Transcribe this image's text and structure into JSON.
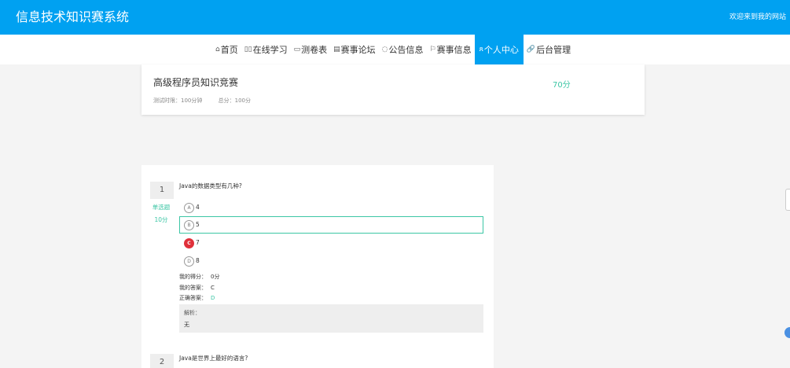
{
  "header": {
    "site_title": "信息技术知识赛系统",
    "welcome": "欢迎来到我的网站"
  },
  "nav": {
    "items": [
      {
        "label": "首页",
        "icon": "home-icon",
        "glyph": "⌂"
      },
      {
        "label": "在线学习",
        "icon": "book-icon",
        "glyph": "▯▯"
      },
      {
        "label": "测卷表",
        "icon": "paper-icon",
        "glyph": "▭"
      },
      {
        "label": "赛事论坛",
        "icon": "forum-icon",
        "glyph": "▤"
      },
      {
        "label": "公告信息",
        "icon": "notice-icon",
        "glyph": "◌"
      },
      {
        "label": "赛事信息",
        "icon": "flag-icon",
        "glyph": "⚐"
      },
      {
        "label": "个人中心",
        "icon": "user-icon",
        "glyph": "ጸ"
      },
      {
        "label": "后台管理",
        "icon": "link-icon",
        "glyph": "🔗"
      }
    ],
    "active": "个人中心"
  },
  "exam": {
    "title": "高级程序员知识竞赛",
    "duration": "测试时限：100分钟",
    "total": "总分：100分",
    "score": "70分"
  },
  "questions": [
    {
      "number": "1",
      "type": "单选题",
      "points": "10分",
      "text": "Java的数据类型有几种?",
      "options": [
        {
          "letter": "A",
          "text": "4",
          "selected": false,
          "wrong": false
        },
        {
          "letter": "B",
          "text": "5",
          "selected": true,
          "wrong": false
        },
        {
          "letter": "C",
          "text": "7",
          "selected": false,
          "wrong": true
        },
        {
          "letter": "D",
          "text": "8",
          "selected": false,
          "wrong": false
        }
      ],
      "my_score_label": "我的得分：",
      "my_score": "0分",
      "my_answer_label": "我的答案：",
      "my_answer": "C",
      "correct_label": "正确答案：",
      "correct_answer": "D",
      "analysis_label": "解析：",
      "analysis_text": "无"
    },
    {
      "number": "2",
      "text": "Java是世界上最好的语言?"
    }
  ],
  "colors": {
    "primary": "#00a1f1",
    "accent": "#3cc6a5",
    "wrong": "#e0303a"
  }
}
